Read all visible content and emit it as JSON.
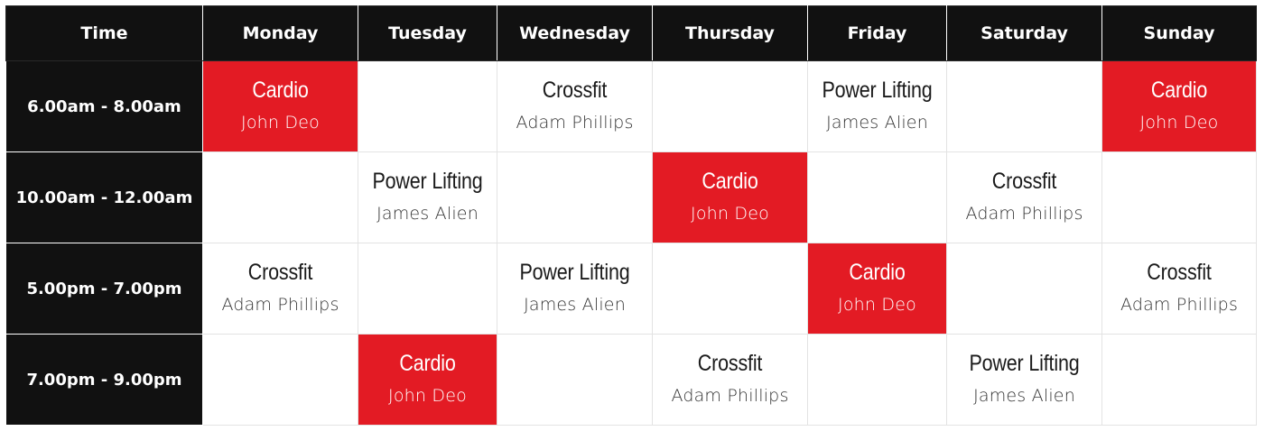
{
  "schedule": {
    "headers": [
      "Time",
      "Monday",
      "Tuesday",
      "Wednesday",
      "Thursday",
      "Friday",
      "Saturday",
      "Sunday"
    ],
    "highlight_color": "#e31b24",
    "header_color": "#111111",
    "rows": [
      {
        "time": "6.00am - 8.00am",
        "cells": [
          {
            "name": "Cardio",
            "trainer": "John Deo",
            "highlight": true
          },
          null,
          {
            "name": "Crossfit",
            "trainer": "Adam Phillips",
            "highlight": false
          },
          null,
          {
            "name": "Power Lifting",
            "trainer": "James Alien",
            "highlight": false
          },
          null,
          {
            "name": "Cardio",
            "trainer": "John Deo",
            "highlight": true
          }
        ]
      },
      {
        "time": "10.00am - 12.00am",
        "cells": [
          null,
          {
            "name": "Power Lifting",
            "trainer": "James Alien",
            "highlight": false
          },
          null,
          {
            "name": "Cardio",
            "trainer": "John Deo",
            "highlight": true
          },
          null,
          {
            "name": "Crossfit",
            "trainer": "Adam Phillips",
            "highlight": false
          },
          null
        ]
      },
      {
        "time": "5.00pm - 7.00pm",
        "cells": [
          {
            "name": "Crossfit",
            "trainer": "Adam Phillips",
            "highlight": false
          },
          null,
          {
            "name": "Power Lifting",
            "trainer": "James Alien",
            "highlight": false
          },
          null,
          {
            "name": "Cardio",
            "trainer": "John Deo",
            "highlight": true
          },
          null,
          {
            "name": "Crossfit",
            "trainer": "Adam Phillips",
            "highlight": false
          }
        ]
      },
      {
        "time": "7.00pm - 9.00pm",
        "cells": [
          null,
          {
            "name": "Cardio",
            "trainer": "John Deo",
            "highlight": true
          },
          null,
          {
            "name": "Crossfit",
            "trainer": "Adam Phillips",
            "highlight": false
          },
          null,
          {
            "name": "Power Lifting",
            "trainer": "James Alien",
            "highlight": false
          },
          null
        ]
      }
    ]
  }
}
